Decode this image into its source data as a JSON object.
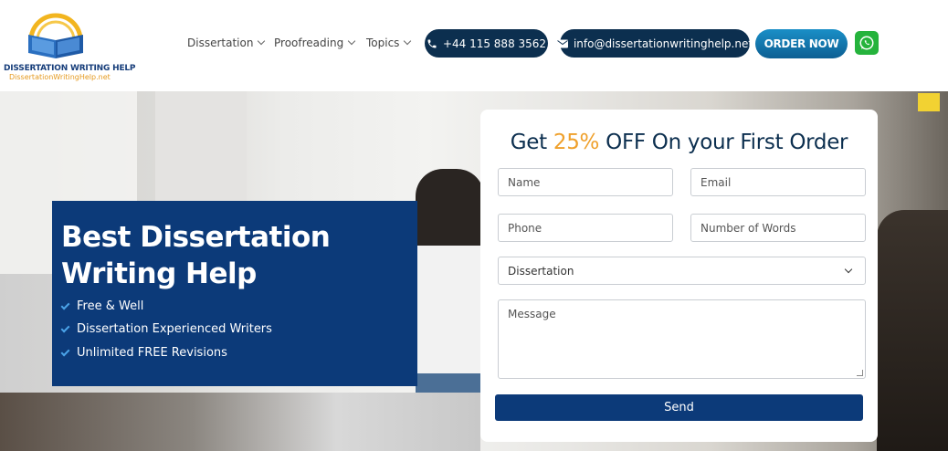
{
  "logo": {
    "title": "DISSERTATION WRITING HELP",
    "subtitle": "DissertationWritingHelp.net"
  },
  "nav": [
    {
      "label": "Dissertation"
    },
    {
      "label": "Proofreading"
    },
    {
      "label": "Topics"
    }
  ],
  "contact": {
    "phone": "+44 115 888 3562",
    "email": "info@dissertationwritinghelp.net"
  },
  "order_label": "ORDER NOW",
  "promo": {
    "heading": "Best Dissertation Writing Help",
    "features": [
      "Free & Well",
      "Dissertation Experienced Writers",
      "Unlimited FREE Revisions"
    ]
  },
  "form": {
    "title_pre": "Get ",
    "title_highlight": "25%",
    "title_post": " OFF On your First Order",
    "name_placeholder": "Name",
    "email_placeholder": "Email",
    "phone_placeholder": "Phone",
    "words_placeholder": "Number of Words",
    "service_selected": "Dissertation",
    "message_placeholder": "Message",
    "send_label": "Send"
  },
  "colors": {
    "navy": "#0c3a79",
    "pill": "#0c2f4f",
    "accent": "#efa02b",
    "whatsapp": "#25b33c"
  },
  "icons": [
    "logo-book-icon",
    "phone-icon",
    "envelope-icon",
    "whatsapp-icon",
    "chevron-down-icon",
    "check-icon"
  ]
}
